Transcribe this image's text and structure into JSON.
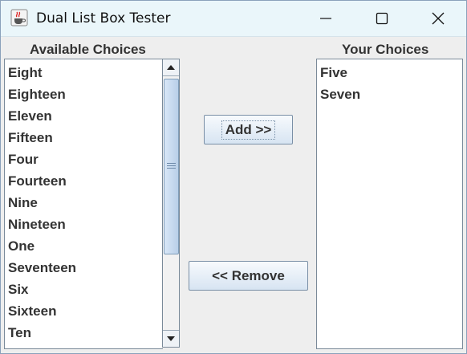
{
  "window": {
    "title": "Dual List Box Tester"
  },
  "available": {
    "header": "Available Choices",
    "items": [
      "Eight",
      "Eighteen",
      "Eleven",
      "Fifteen",
      "Four",
      "Fourteen",
      "Nine",
      "Nineteen",
      "One",
      "Seventeen",
      "Six",
      "Sixteen",
      "Ten"
    ]
  },
  "chosen": {
    "header": "Your Choices",
    "items": [
      "Five",
      "Seven"
    ]
  },
  "buttons": {
    "add": "Add >>",
    "remove": "<< Remove"
  },
  "icons": {
    "app": "java-cup-icon",
    "minimize": "minimize-icon",
    "maximize": "maximize-icon",
    "close": "close-icon"
  }
}
